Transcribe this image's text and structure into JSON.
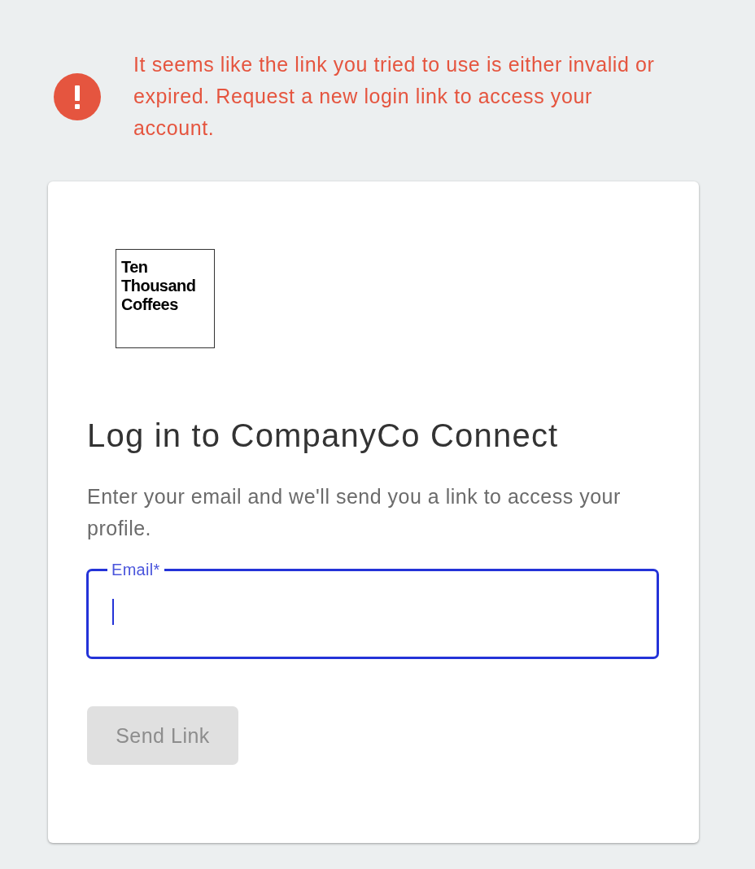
{
  "alert": {
    "kind": "error",
    "message": "It seems like the link you tried to use is either invalid or expired. Request a new login link to access your account."
  },
  "card": {
    "logo": {
      "text": "Ten Thousand Coffees"
    },
    "title": "Log in to CompanyCo Connect",
    "description": "Enter your email and we'll send you a link to access your profile.",
    "email_field": {
      "label": "Email*",
      "focused": true
    },
    "button": {
      "label": "Send Link",
      "disabled": true
    }
  }
}
